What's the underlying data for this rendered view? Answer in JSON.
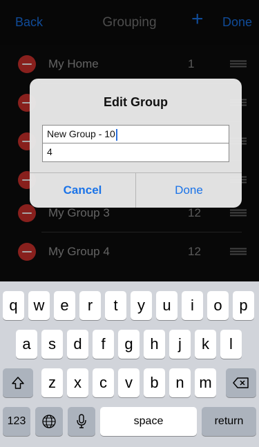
{
  "navbar": {
    "back_label": "Back",
    "title": "Grouping",
    "add_label": "+",
    "done_label": "Done"
  },
  "list": {
    "rows": [
      {
        "name": "My Home",
        "count": "1"
      },
      {
        "name": "My Group 3",
        "count": "12"
      },
      {
        "name": "My Group 4",
        "count": "12"
      }
    ]
  },
  "dialog": {
    "title": "Edit Group",
    "name_value": "New Group - 10",
    "number_value": "4",
    "cancel_label": "Cancel",
    "done_label": "Done"
  },
  "keyboard": {
    "row1": [
      "q",
      "w",
      "e",
      "r",
      "t",
      "y",
      "u",
      "i",
      "o",
      "p"
    ],
    "row2": [
      "a",
      "s",
      "d",
      "f",
      "g",
      "h",
      "j",
      "k",
      "l"
    ],
    "row3": [
      "z",
      "x",
      "c",
      "v",
      "b",
      "n",
      "m"
    ],
    "numbers_label": "123",
    "space_label": "space",
    "return_label": "return",
    "icons": {
      "shift": "shift-icon",
      "delete": "delete-icon",
      "globe": "globe-icon",
      "mic": "microphone-icon"
    }
  },
  "colors": {
    "accent": "#1a73e8",
    "delete_red": "#d2322d"
  }
}
